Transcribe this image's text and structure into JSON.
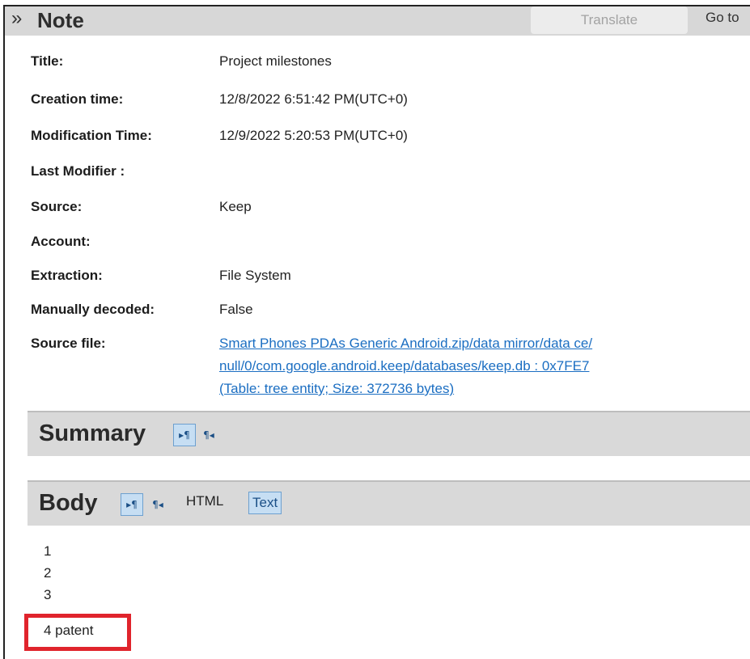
{
  "header": {
    "expand_icon": "chevron-double-right",
    "title": "Note",
    "translate_label": "Translate",
    "goto_label": "Go to"
  },
  "properties": [
    {
      "label": "Title:",
      "value": "Project milestones"
    },
    {
      "label": "Creation time:",
      "value": "12/8/2022 6:51:42 PM(UTC+0)"
    },
    {
      "label": "Modification Time:",
      "value": "12/9/2022 5:20:53 PM(UTC+0)"
    },
    {
      "label": "Last Modifier :",
      "value": ""
    },
    {
      "label": "Source:",
      "value": "Keep"
    },
    {
      "label": "Account:",
      "value": ""
    },
    {
      "label": "Extraction:",
      "value": "File System"
    },
    {
      "label": "Manually decoded:",
      "value": "False"
    },
    {
      "label": "Source file:",
      "value": ""
    }
  ],
  "source_file_link": [
    "Smart Phones PDAs Generic Android.zip/data mirror/data ce/",
    "null/0/com.google.android.keep/databases/keep.db : 0x7FE7",
    "(Table: tree entity; Size: 372736 bytes)"
  ],
  "summary": {
    "title": "Summary",
    "ltr_icon": "▸¶",
    "rtl_icon": "¶◂"
  },
  "body_section": {
    "title": "Body",
    "ltr_icon": "▸¶",
    "rtl_icon": "¶◂",
    "html_label": "HTML",
    "text_label": "Text"
  },
  "body_lines": [
    "1",
    "2",
    "3",
    "4 patent"
  ],
  "colors": {
    "header_bg": "#d7d7d7",
    "section_bg": "#d9d9d9",
    "link": "#1b6ec2",
    "active_toggle": "#c6def3",
    "highlight": "#e0242c"
  }
}
